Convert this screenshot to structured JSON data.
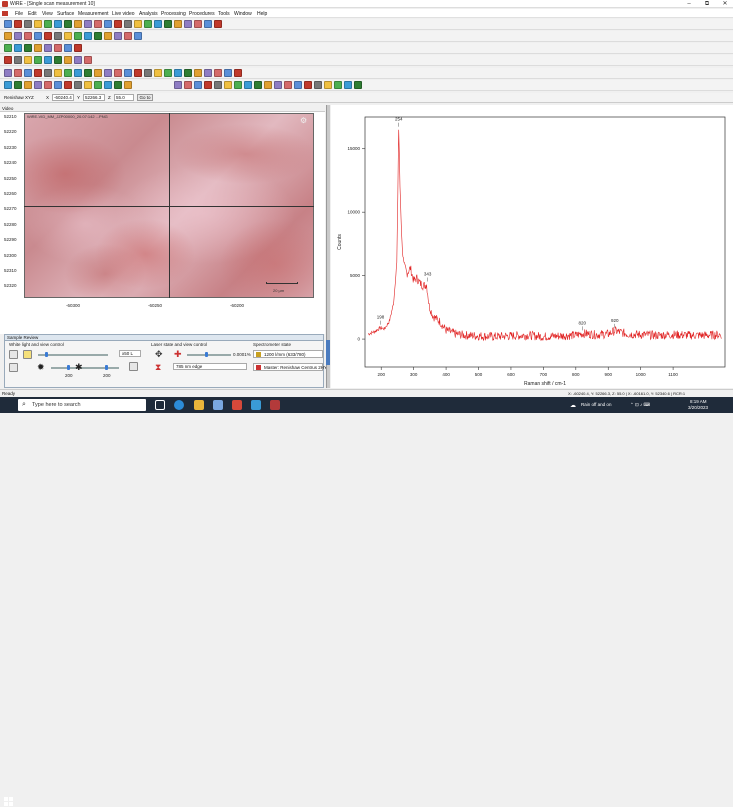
{
  "window": {
    "title": "WiRE - [Single scan measurement 10]",
    "minimize": "–",
    "restore": "⧉",
    "close": "✕"
  },
  "menu": [
    "File",
    "Edit",
    "View",
    "Surface",
    "Measurement",
    "Live video",
    "Analysis",
    "Processing",
    "Procedures",
    "Tools",
    "Window",
    "Help"
  ],
  "xyz": {
    "label": "Renishaw XYZ",
    "x_label": "X",
    "x_value": "-60240.4",
    "y_label": "Y",
    "y_value": "52266.3",
    "z_label": "Z",
    "z_value": "55.0",
    "go_label": "Go to"
  },
  "video": {
    "header": "Video",
    "caption": "WiRE-VID_MM_JZP00000_20.07:142 ...PNG",
    "y_ticks": [
      "52210",
      "52220",
      "52230",
      "52240",
      "52250",
      "52260",
      "52270",
      "52280",
      "52290",
      "52300",
      "52310",
      "52320"
    ],
    "x_ticks": [
      "-60300",
      "-60250",
      "-60200"
    ],
    "scalebar_label": "20 µm"
  },
  "sample_review": {
    "title": "Sample Review",
    "white_light_label": "White light and view control",
    "laser_label": "Laser state and view control",
    "spectrometer_label": "Spectrometer state",
    "mag_option": "x50 L",
    "percent": "0.0001%",
    "val_a": "200",
    "val_b": "200",
    "val_c": "300",
    "laser_edge": "785 nm edge",
    "grating": "1200 l/mm (633/780)",
    "master": "Master: Renishaw Centrus 2HY"
  },
  "chart_data": {
    "type": "line",
    "xlabel": "Raman shift / cm-1",
    "ylabel": "Counts",
    "xlim": [
      150,
      1260
    ],
    "ylim": [
      -2200,
      17500
    ],
    "x_ticks": [
      200,
      300,
      400,
      500,
      600,
      700,
      800,
      900,
      1000,
      1100
    ],
    "y_ticks": [
      0,
      5000,
      10000,
      15000
    ],
    "series": [
      {
        "color": "#e02020",
        "points": [
          [
            160,
            400
          ],
          [
            180,
            600
          ],
          [
            198,
            900
          ],
          [
            210,
            800
          ],
          [
            225,
            1400
          ],
          [
            238,
            2800
          ],
          [
            248,
            6000
          ],
          [
            254,
            16500
          ],
          [
            258,
            12000
          ],
          [
            264,
            7500
          ],
          [
            270,
            5800
          ],
          [
            280,
            5200
          ],
          [
            290,
            5600
          ],
          [
            300,
            4600
          ],
          [
            310,
            4800
          ],
          [
            320,
            4400
          ],
          [
            330,
            4200
          ],
          [
            340,
            4300
          ],
          [
            348,
            2600
          ],
          [
            360,
            1800
          ],
          [
            380,
            1400
          ],
          [
            400,
            700
          ],
          [
            430,
            400
          ],
          [
            460,
            300
          ],
          [
            500,
            250
          ],
          [
            550,
            200
          ],
          [
            600,
            250
          ],
          [
            650,
            300
          ],
          [
            700,
            200
          ],
          [
            750,
            250
          ],
          [
            800,
            300
          ],
          [
            820,
            450
          ],
          [
            860,
            350
          ],
          [
            900,
            400
          ],
          [
            920,
            650
          ],
          [
            960,
            400
          ],
          [
            1000,
            350
          ],
          [
            1050,
            300
          ],
          [
            1100,
            350
          ],
          [
            1150,
            300
          ],
          [
            1200,
            300
          ],
          [
            1250,
            350
          ]
        ]
      }
    ],
    "peak_labels": [
      {
        "x": 198,
        "y": 900,
        "text": "198"
      },
      {
        "x": 254,
        "y": 16500,
        "text": "254"
      },
      {
        "x": 343,
        "y": 4300,
        "text": "343"
      },
      {
        "x": 820,
        "y": 450,
        "text": "820"
      },
      {
        "x": 920,
        "y": 650,
        "text": "920"
      }
    ],
    "noise_amplitude": 700,
    "grid": false
  },
  "status": {
    "left": "Ready",
    "right": "X: -60240.4, Y: 52266.3, Z: 55.0 | X: -60161.0, Y: 52340.6 | RCR:1"
  },
  "taskbar": {
    "search_placeholder": "Type here to search",
    "tray_text": "Rain off and on",
    "time": "8:19 AM",
    "date": "3/20/2023"
  }
}
